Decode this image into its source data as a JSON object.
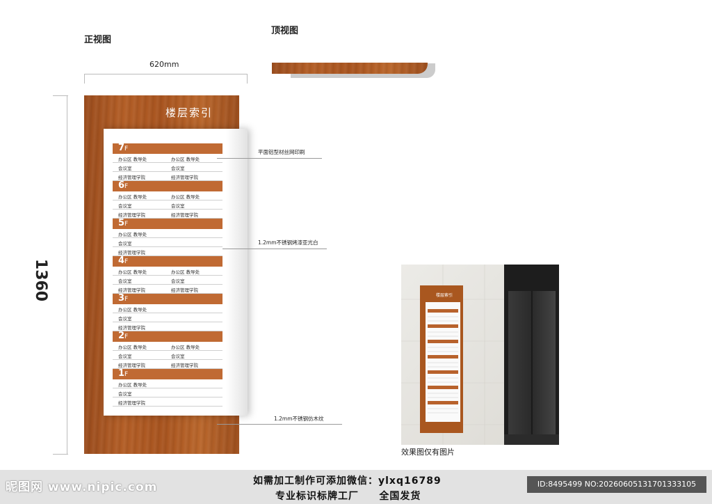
{
  "headings": {
    "front_view": "正视图",
    "top_view": "顶视图"
  },
  "dimensions": {
    "width": "620mm",
    "height": "1360"
  },
  "sign": {
    "title": "楼层索引",
    "floors": [
      {
        "label": "7",
        "unit": "F",
        "rows": [
          [
            "办公区 教导处",
            "办公区 教导处"
          ],
          [
            "会议室",
            "会议室"
          ],
          [
            "经济管理学院",
            "经济管理学院"
          ]
        ]
      },
      {
        "label": "6",
        "unit": "F",
        "rows": [
          [
            "办公区 教导处",
            "办公区 教导处"
          ],
          [
            "会议室",
            "会议室"
          ],
          [
            "经济管理学院",
            "经济管理学院"
          ]
        ]
      },
      {
        "label": "5",
        "unit": "F",
        "rows": [
          [
            "办公区 教导处",
            ""
          ],
          [
            "会议室",
            ""
          ],
          [
            "经济管理学院",
            ""
          ]
        ]
      },
      {
        "label": "4",
        "unit": "F",
        "rows": [
          [
            "办公区 教导处",
            "办公区 教导处"
          ],
          [
            "会议室",
            "会议室"
          ],
          [
            "经济管理学院",
            "经济管理学院"
          ]
        ]
      },
      {
        "label": "3",
        "unit": "F",
        "rows": [
          [
            "办公区 教导处",
            ""
          ],
          [
            "会议室",
            ""
          ],
          [
            "经济管理学院",
            ""
          ]
        ]
      },
      {
        "label": "2",
        "unit": "F",
        "rows": [
          [
            "办公区 教导处",
            "办公区 教导处"
          ],
          [
            "会议室",
            "会议室"
          ],
          [
            "经济管理学院",
            "经济管理学院"
          ]
        ]
      },
      {
        "label": "1",
        "unit": "F",
        "rows": [
          [
            "办公区 教导处",
            ""
          ],
          [
            "会议室",
            ""
          ],
          [
            "经济管理学院",
            ""
          ]
        ]
      }
    ]
  },
  "annotations": {
    "print": "平面铝型材丝网印刷",
    "panel": "1.2mm不锈钢烤漆亚光白",
    "wood": "1.2mm不锈钢仿木纹"
  },
  "photo": {
    "caption": "效果图仅有图片",
    "sign_title": "楼层索引"
  },
  "footer": {
    "logo": "昵图网 www.nipic.com",
    "line1": "如需加工制作可添加微信：ylxq16789",
    "line2": "专业标识标牌工厂     全国发货",
    "id": "ID:8495499 NO:20260605131701333105"
  },
  "colors": {
    "wood": "#b35e26",
    "floor_bar": "#c06a33",
    "footer_bg": "#e2e2e2"
  }
}
